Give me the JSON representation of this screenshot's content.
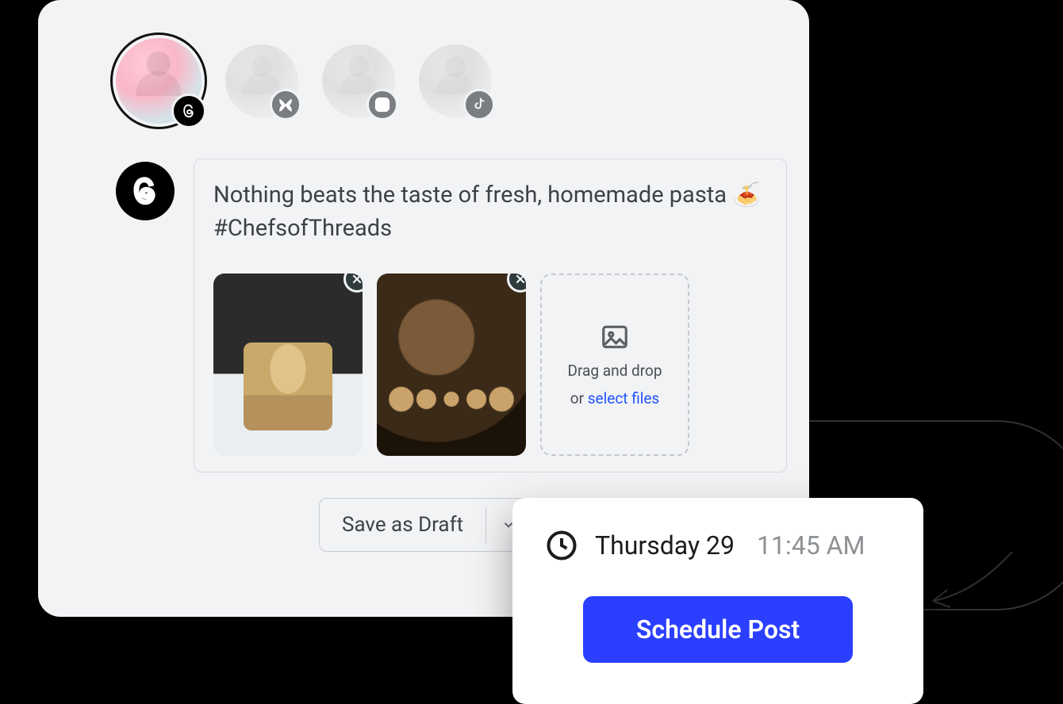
{
  "accounts": [
    {
      "platform": "threads",
      "selected": true
    },
    {
      "platform": "bluesky",
      "selected": false
    },
    {
      "platform": "instagram",
      "selected": false
    },
    {
      "platform": "tiktok",
      "selected": false
    }
  ],
  "compose": {
    "platform_icon": "threads",
    "text": "Nothing beats the taste of fresh, homemade pasta 🍝\n#ChefsofThreads",
    "media_count": 2
  },
  "dropzone": {
    "line1": "Drag and drop",
    "line2_prefix": "or ",
    "link": "select files"
  },
  "draft_button": {
    "label": "Save as Draft"
  },
  "schedule": {
    "date": "Thursday 29",
    "time": "11:45 AM",
    "button": "Schedule Post"
  },
  "colors": {
    "accent": "#2b3fff",
    "link": "#2255ff"
  }
}
